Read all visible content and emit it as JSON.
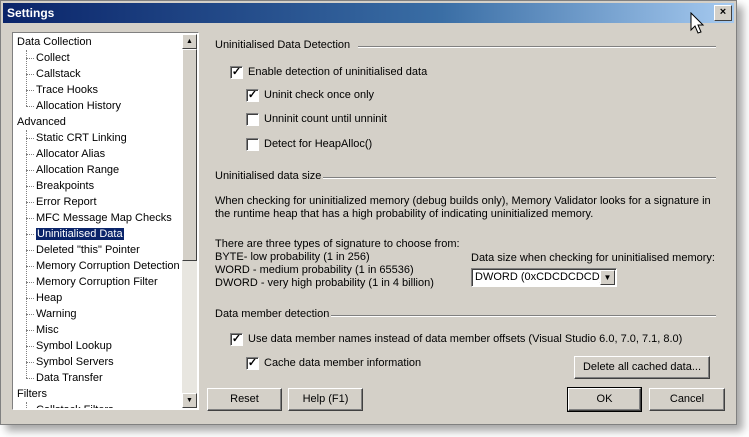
{
  "window": {
    "title": "Settings",
    "close_glyph": "×"
  },
  "tree": {
    "items": [
      {
        "label": "Data Collection",
        "level": 0
      },
      {
        "label": "Collect",
        "level": 1
      },
      {
        "label": "Callstack",
        "level": 1
      },
      {
        "label": "Trace Hooks",
        "level": 1
      },
      {
        "label": "Allocation History",
        "level": 1
      },
      {
        "label": "Advanced",
        "level": 0
      },
      {
        "label": "Static CRT Linking",
        "level": 1
      },
      {
        "label": "Allocator Alias",
        "level": 1
      },
      {
        "label": "Allocation Range",
        "level": 1
      },
      {
        "label": "Breakpoints",
        "level": 1
      },
      {
        "label": "Error Report",
        "level": 1
      },
      {
        "label": "MFC Message Map Checks",
        "level": 1
      },
      {
        "label": "Uninitialised Data",
        "level": 1,
        "selected": true
      },
      {
        "label": "Deleted \"this\" Pointer",
        "level": 1
      },
      {
        "label": "Memory Corruption Detection",
        "level": 1
      },
      {
        "label": "Memory Corruption Filter",
        "level": 1
      },
      {
        "label": "Heap",
        "level": 1
      },
      {
        "label": "Warning",
        "level": 1
      },
      {
        "label": "Misc",
        "level": 1
      },
      {
        "label": "Symbol Lookup",
        "level": 1
      },
      {
        "label": "Symbol Servers",
        "level": 1
      },
      {
        "label": "Data Transfer",
        "level": 1
      },
      {
        "label": "Filters",
        "level": 0
      },
      {
        "label": "Callstack Filters",
        "level": 1
      }
    ]
  },
  "detection": {
    "title": "Uninitialised Data Detection",
    "enable": {
      "label": "Enable detection of uninitialised data",
      "checked": true
    },
    "once": {
      "label": "Uninit check once only",
      "checked": true
    },
    "count": {
      "label": "Unninit count until unninit",
      "checked": false
    },
    "heapalloc": {
      "label": "Detect for HeapAlloc()",
      "checked": false
    }
  },
  "size": {
    "title": "Uninitialised data size",
    "desc1": "When checking for uninitialized memory (debug builds only), Memory Validator looks for a signature in",
    "desc2": "the runtime heap that has a high probability of indicating uninitialized memory.",
    "types_intro": "There are three types of signature to choose from:",
    "byte": "BYTE- low probability (1 in 256)",
    "word": "WORD - medium probability (1 in 65536)",
    "dword": "DWORD - very high probability (1 in 4 billion)",
    "select_label": "Data size when checking for uninitialised memory:",
    "select_value": "DWORD (0xCDCDCDCD)"
  },
  "member": {
    "title": "Data member detection",
    "use_names": {
      "label": "Use data member names instead of data member offsets (Visual Studio 6.0, 7.0, 7.1, 8.0)",
      "checked": true
    },
    "cache": {
      "label": "Cache data member information",
      "checked": true
    },
    "delete_btn": "Delete all cached data..."
  },
  "buttons": {
    "reset": "Reset",
    "help": "Help (F1)",
    "ok": "OK",
    "cancel": "Cancel"
  },
  "check_glyph": "✓",
  "arrows": {
    "up": "▲",
    "down": "▼"
  }
}
